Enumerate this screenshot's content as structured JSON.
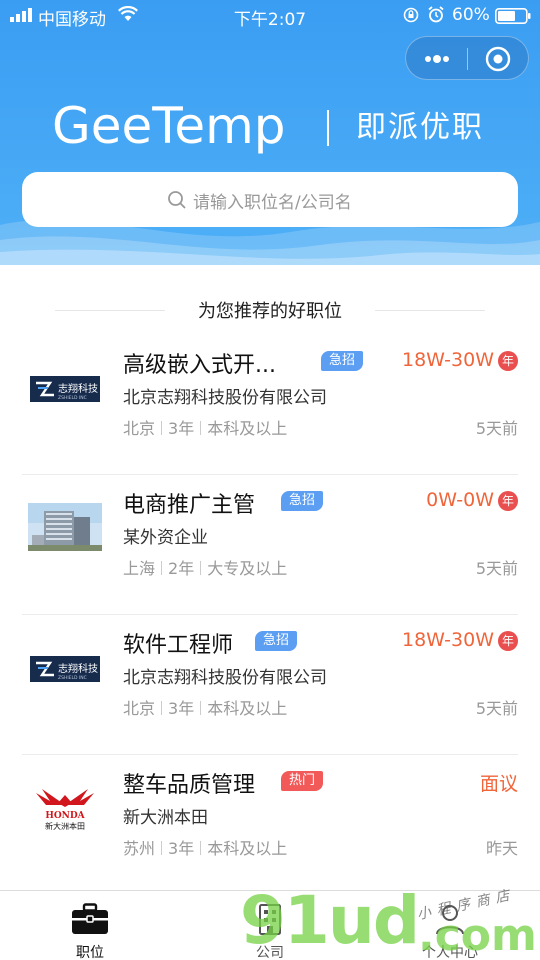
{
  "status_bar": {
    "carrier": "中国移动",
    "time": "下午2:07",
    "battery": "60%"
  },
  "header": {
    "logo_en": "GeeTemp",
    "logo_cn": "即派优职",
    "search_placeholder": "请输入职位名/公司名"
  },
  "section": {
    "title": "为您推荐的好职位"
  },
  "jobs": [
    {
      "title": "高级嵌入式开...",
      "tag": "急招",
      "salary": "18W-30W",
      "salary_unit": "年",
      "company": "北京志翔科技股份有限公司",
      "city": "北京",
      "experience": "3年",
      "education": "本科及以上",
      "posted": "5天前",
      "logo": {
        "type": "zhixiang",
        "name": "志翔科技",
        "sub": "ZSHIELD INC"
      }
    },
    {
      "title": "电商推广主管",
      "tag": "急招",
      "salary": "0W-0W",
      "salary_unit": "年",
      "company": "某外资企业",
      "city": "上海",
      "experience": "2年",
      "education": "大专及以上",
      "posted": "5天前",
      "logo": {
        "type": "building"
      }
    },
    {
      "title": "软件工程师",
      "tag": "急招",
      "salary": "18W-30W",
      "salary_unit": "年",
      "company": "北京志翔科技股份有限公司",
      "city": "北京",
      "experience": "3年",
      "education": "本科及以上",
      "posted": "5天前",
      "logo": {
        "type": "zhixiang",
        "name": "志翔科技",
        "sub": "ZSHIELD INC"
      }
    },
    {
      "title": "整车品质管理",
      "tag": "热门",
      "salary": "面议",
      "salary_unit": "",
      "company": "新大洲本田",
      "city": "苏州",
      "experience": "3年",
      "education": "本科及以上",
      "posted": "昨天",
      "logo": {
        "type": "honda",
        "name": "HONDA",
        "sub": "新大洲本田"
      }
    }
  ],
  "tabbar": {
    "tabs": [
      {
        "label": "职位",
        "icon": "briefcase-icon",
        "active": true
      },
      {
        "label": "公司",
        "icon": "building-icon",
        "active": false
      },
      {
        "label": "个人中心",
        "icon": "person-icon",
        "active": false
      }
    ]
  },
  "watermark": {
    "text_big": "91ud",
    "text_com": ".com",
    "text_small": "小程序商店"
  },
  "colors": {
    "header_blue": "#3a9df2",
    "salary_orange": "#f0653a",
    "urgent_blue": "#5b9ef2",
    "hot_red": "#f25a5a",
    "year_badge_red": "#ea4f4f",
    "watermark_green": "#76d246"
  }
}
